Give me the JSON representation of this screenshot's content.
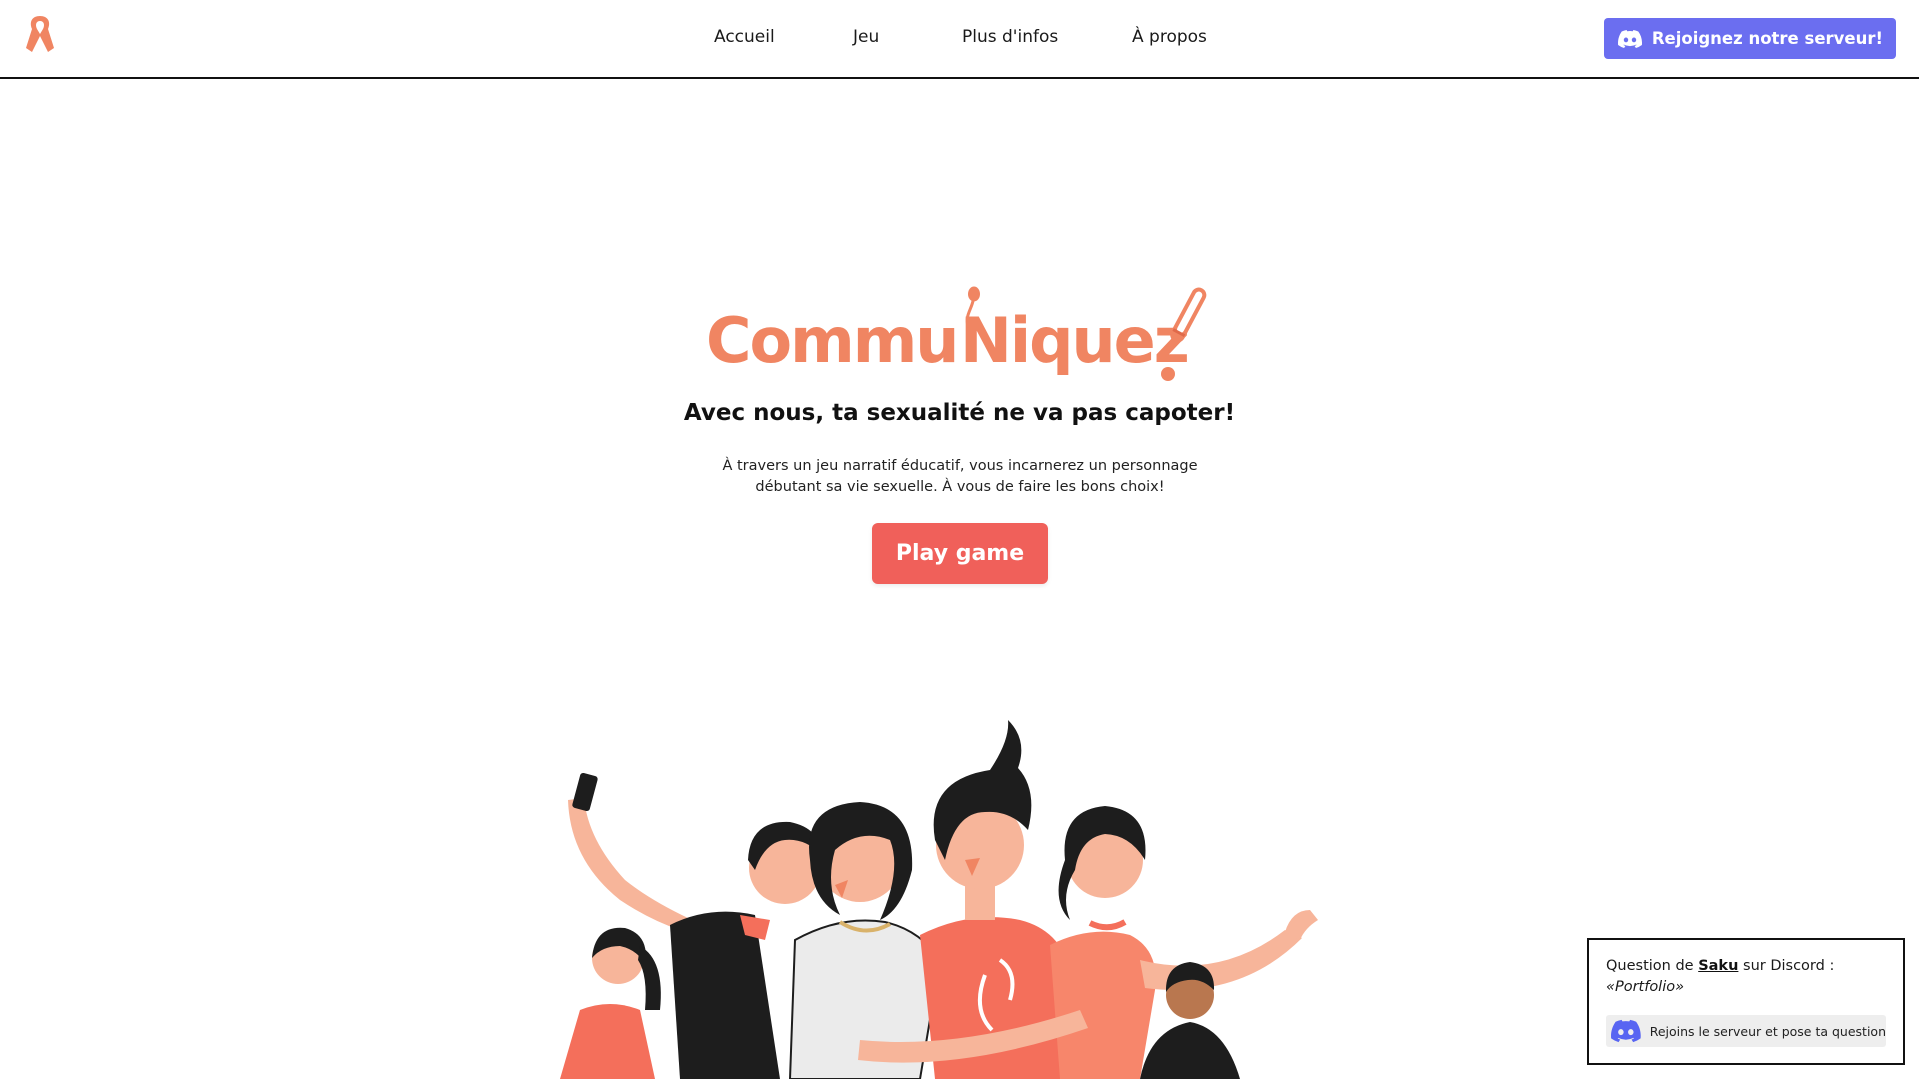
{
  "header": {
    "logo_icon": "ribbon-icon",
    "nav": [
      {
        "label": "Accueil"
      },
      {
        "label": "Jeu"
      },
      {
        "label": "Plus d'infos"
      },
      {
        "label": "À propos"
      }
    ],
    "discord_button": {
      "label": "Rejoignez notre serveur!",
      "icon": "discord-icon"
    }
  },
  "hero": {
    "logo_text": "CommuNiquez!",
    "logo_text_part1": "Commu",
    "logo_text_part2": "Niquez",
    "tagline": "Avec nous, ta sexualité ne va pas capoter!",
    "description": "À travers un jeu narratif éducatif, vous incarnerez un personnage débutant sa vie sexuelle. À vous de faire les bons choix!",
    "play_button": "Play game",
    "illustration": "group-of-friends-selfie-illustration"
  },
  "question_card": {
    "prefix": "Question de ",
    "user": "Saku",
    "suffix": " sur Discord :",
    "topic": "«Portfolio»",
    "join_label": "Rejoins le serveur et pose ta question",
    "icon": "discord-icon"
  },
  "colors": {
    "brand_orange": "#f08562",
    "play_red": "#f0605a",
    "discord_blurple": "#6b6ef0",
    "shirt_coral": "#f46f5b",
    "shirt_black": "#1d1d1d",
    "skin": "#f7b59a"
  }
}
